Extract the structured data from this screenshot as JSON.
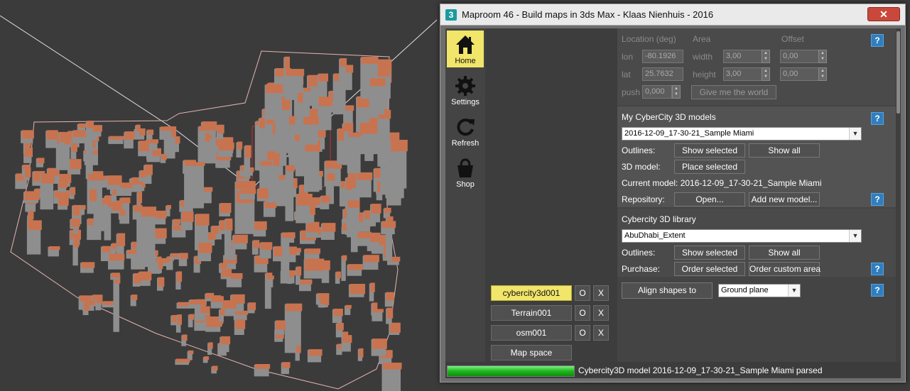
{
  "window": {
    "title": "Maproom 46 - Build maps in 3ds Max - Klaas Nienhuis - 2016",
    "app_icon": "3",
    "close_label": "✕"
  },
  "sidebar": {
    "items": [
      {
        "label": "Home",
        "icon": "home-icon",
        "active": true
      },
      {
        "label": "Settings",
        "icon": "gear-icon",
        "active": false
      },
      {
        "label": "Refresh",
        "icon": "refresh-icon",
        "active": false
      },
      {
        "label": "Shop",
        "icon": "shopping-bag-icon",
        "active": false
      }
    ]
  },
  "objects": [
    {
      "label": "cybercity3d001",
      "selected": true,
      "o_label": "O",
      "x_label": "X"
    },
    {
      "label": "Terrain001",
      "selected": false,
      "o_label": "O",
      "x_label": "X"
    },
    {
      "label": "osm001",
      "selected": false,
      "o_label": "O",
      "x_label": "X"
    },
    {
      "label": "Map space",
      "selected": false
    }
  ],
  "location": {
    "header_location": "Location (deg)",
    "header_area": "Area",
    "header_offset": "Offset",
    "lon_label": "lon",
    "lon_value": "-80.1926",
    "lat_label": "lat",
    "lat_value": "25.7632",
    "width_label": "width",
    "width_value": "3,00",
    "height_label": "height",
    "height_value": "3,00",
    "offset_x_value": "0,00",
    "offset_y_value": "0,00",
    "push_label": "push",
    "push_value": "0,000",
    "give_world_label": "Give me the world",
    "help": "?"
  },
  "my_models": {
    "title": "My CyberCity 3D models",
    "selected_model": "2016-12-09_17-30-21_Sample Miami",
    "outlines_label": "Outlines:",
    "show_selected": "Show selected",
    "show_all": "Show all",
    "model_label": "3D model:",
    "place_selected": "Place selected",
    "current_model": "Current model: 2016-12-09_17-30-21_Sample Miami",
    "repository_label": "Repository:",
    "open_label": "Open...",
    "add_model_label": "Add new model...",
    "help": "?"
  },
  "library": {
    "title": "Cybercity 3D library",
    "selected": "AbuDhabi_Extent",
    "outlines_label": "Outlines:",
    "show_selected": "Show selected",
    "show_all": "Show all",
    "purchase_label": "Purchase:",
    "order_selected": "Order selected",
    "order_custom": "Order custom area",
    "help": "?"
  },
  "align": {
    "button_label": "Align shapes to",
    "option": "Ground plane",
    "help": "?"
  },
  "status": {
    "progress": 1.0,
    "text": "Cybercity3D model 2016-12-09_17-30-21_Sample Miami parsed"
  },
  "colors": {
    "accent_yellow": "#f1e56a",
    "help_blue": "#2f7fc0",
    "building_orange": "#c8734f",
    "building_gray": "#8e8e8e",
    "progress_green": "#1fb51f"
  }
}
